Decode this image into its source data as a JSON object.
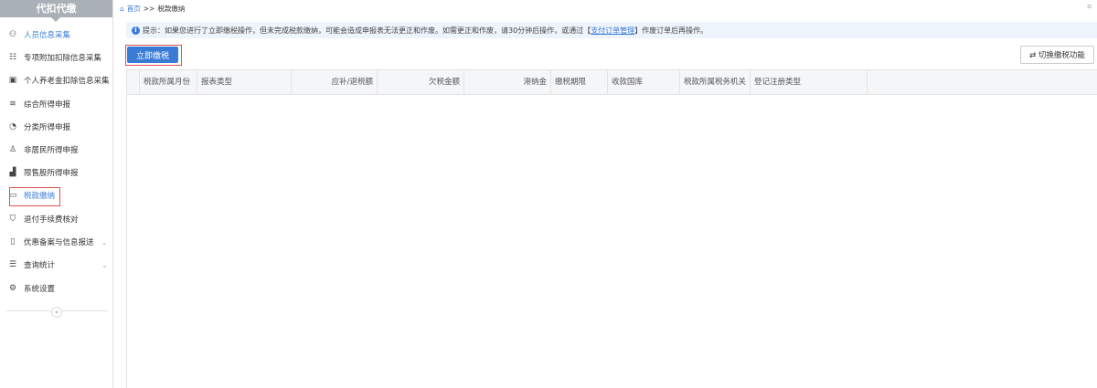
{
  "sidebar": {
    "title": "代扣代缴",
    "items": [
      {
        "label": "人员信息采集",
        "icon": "user-icon"
      },
      {
        "label": "专项附加扣除信息采集",
        "icon": "grid-icon"
      },
      {
        "label": "个人养老金扣除信息采集",
        "icon": "pension-icon"
      },
      {
        "label": "综合所得申报",
        "icon": "layers-icon"
      },
      {
        "label": "分类所得申报",
        "icon": "pie-icon"
      },
      {
        "label": "非居民所得申报",
        "icon": "person-icon"
      },
      {
        "label": "限售股所得申报",
        "icon": "bar-chart-icon"
      },
      {
        "label": "税款缴纳",
        "icon": "folder-icon"
      },
      {
        "label": "退付手续费核对",
        "icon": "shield-icon"
      },
      {
        "label": "优惠备案与信息报送",
        "icon": "document-icon"
      },
      {
        "label": "查询统计",
        "icon": "search-list-icon"
      },
      {
        "label": "系统设置",
        "icon": "gear-icon"
      }
    ]
  },
  "breadcrumb": {
    "home": "首页",
    "sep": ">>",
    "current": "税款缴纳"
  },
  "notice": {
    "prefix": "提示：如果您进行了立即缴税操作，但未完成税款缴纳，可能会造成申报表无法更正和作废。如需更正和作废，请30分钟后操作，或通过【",
    "link": "支付订单管理",
    "suffix": "】作废订单后再操作。"
  },
  "toolbar": {
    "pay_now": "立即缴税",
    "switch": "切换缴税功能"
  },
  "table": {
    "columns": [
      "税款所属月份",
      "报表类型",
      "应补/退税额",
      "欠税金额",
      "滞纳金",
      "缴税期限",
      "收款国库",
      "税款所属税务机关",
      "登记注册类型"
    ]
  }
}
